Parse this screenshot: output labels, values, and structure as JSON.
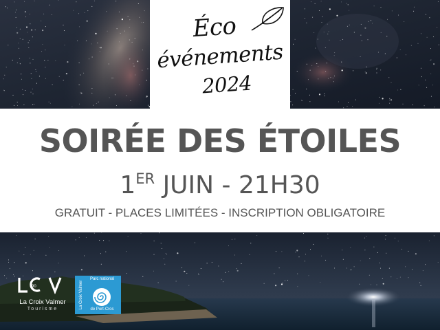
{
  "logo": {
    "line1": "Éco",
    "line2": "événements",
    "line3": "2024",
    "icon": "leaf-icon"
  },
  "event": {
    "title": "SOIRÉE DES ÉTOILES",
    "date_day": "1",
    "date_sup": "ER",
    "date_rest": " JUIN - 21H30",
    "info": "GRATUIT - PLACES LIMITÉES - INSCRIPTION OBLIGATOIRE"
  },
  "partners": {
    "lcv_mark": "LCV",
    "lcv_year": "90",
    "lcv_name": "La Croix Valmer",
    "lcv_sub": "Tourisme",
    "parc_side": "La Croix Valmer",
    "parc_top": "Parc national",
    "parc_bottom": "de Port-Cros",
    "parc_icon": "spiral-icon"
  },
  "colors": {
    "text_grey": "#555555",
    "parc_blue": "#2c9ad3",
    "night_sky": "#1b2433"
  }
}
